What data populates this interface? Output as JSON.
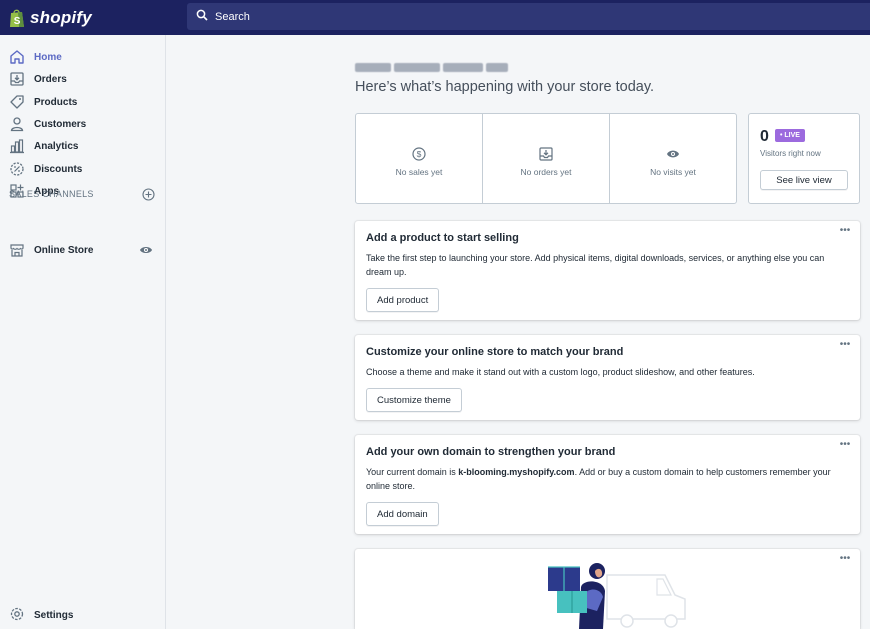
{
  "app": {
    "brand": "shopify"
  },
  "search": {
    "placeholder": "Search"
  },
  "sidebar": {
    "items": [
      {
        "label": "Home",
        "icon": "home-icon"
      },
      {
        "label": "Orders",
        "icon": "orders-icon"
      },
      {
        "label": "Products",
        "icon": "tag-icon"
      },
      {
        "label": "Customers",
        "icon": "person-icon"
      },
      {
        "label": "Analytics",
        "icon": "bar-chart-icon"
      },
      {
        "label": "Discounts",
        "icon": "discount-icon"
      },
      {
        "label": "Apps",
        "icon": "apps-icon"
      }
    ],
    "channels_heading": "SALES CHANNELS",
    "channels": [
      {
        "label": "Online Store",
        "icon": "store-icon"
      }
    ],
    "settings_label": "Settings"
  },
  "main": {
    "subtitle": "Here’s what’s happening with your store today.",
    "stats": [
      {
        "label": "No sales yet",
        "icon": "dollar-icon"
      },
      {
        "label": "No orders yet",
        "icon": "inbox-icon"
      },
      {
        "label": "No visits yet",
        "icon": "eye-icon"
      }
    ],
    "live": {
      "count": "0",
      "badge": "• LIVE",
      "sub": "Visitors right now",
      "button": "See live view"
    },
    "cards": [
      {
        "title": "Add a product to start selling",
        "body": "Take the first step to launching your store. Add physical items, digital downloads, services, or anything else you can dream up.",
        "button": "Add product"
      },
      {
        "title": "Customize your online store to match your brand",
        "body": "Choose a theme and make it stand out with a custom logo, product slideshow, and other features.",
        "button": "Customize theme"
      },
      {
        "title": "Add your own domain to strengthen your brand",
        "body_prefix": "Your current domain is ",
        "body_domain": "k-blooming.myshopify.com",
        "body_suffix": ". Add or buy a custom domain to help customers remember your online store.",
        "button": "Add domain"
      }
    ],
    "more_icon": "ellipsis-icon"
  },
  "colors": {
    "topbar": "#1c2260",
    "accent": "#5c6ac4",
    "live_badge": "#9c6ade"
  }
}
